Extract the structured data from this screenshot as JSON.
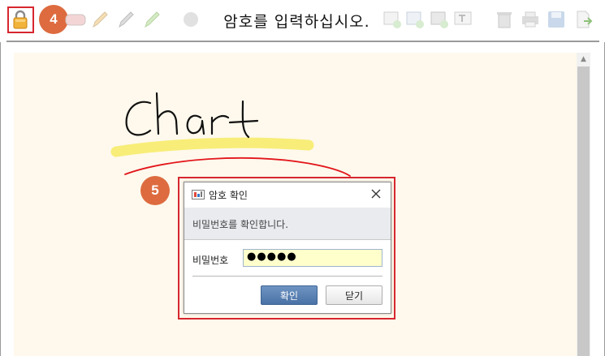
{
  "toolbar": {
    "step_badge": "4",
    "tooltip": "암호를 입력하십시오.",
    "icons": [
      "lock-icon",
      "eraser-icon",
      "pencil-icon",
      "pen-icon",
      "highlighter-icon",
      "dot-icon",
      "color-icon",
      "add-image-icon",
      "add-picture-icon",
      "add-photo-icon",
      "add-text-icon",
      "trash-icon",
      "print-icon",
      "save-icon",
      "export-icon"
    ]
  },
  "canvas": {
    "handwriting": "Chart"
  },
  "dialog": {
    "step_badge": "5",
    "title": "암호 확인",
    "message": "비밀번호를 확인합니다.",
    "password_label": "비밀번호",
    "password_value": "●●●●●",
    "ok_label": "확인",
    "close_label": "닫기"
  },
  "colors": {
    "accent_red": "#d7262f",
    "badge": "#dd6b3f",
    "canvas_bg": "#fef9ec",
    "highlighter": "#f7ec6e",
    "red_ink": "#e3161c"
  }
}
